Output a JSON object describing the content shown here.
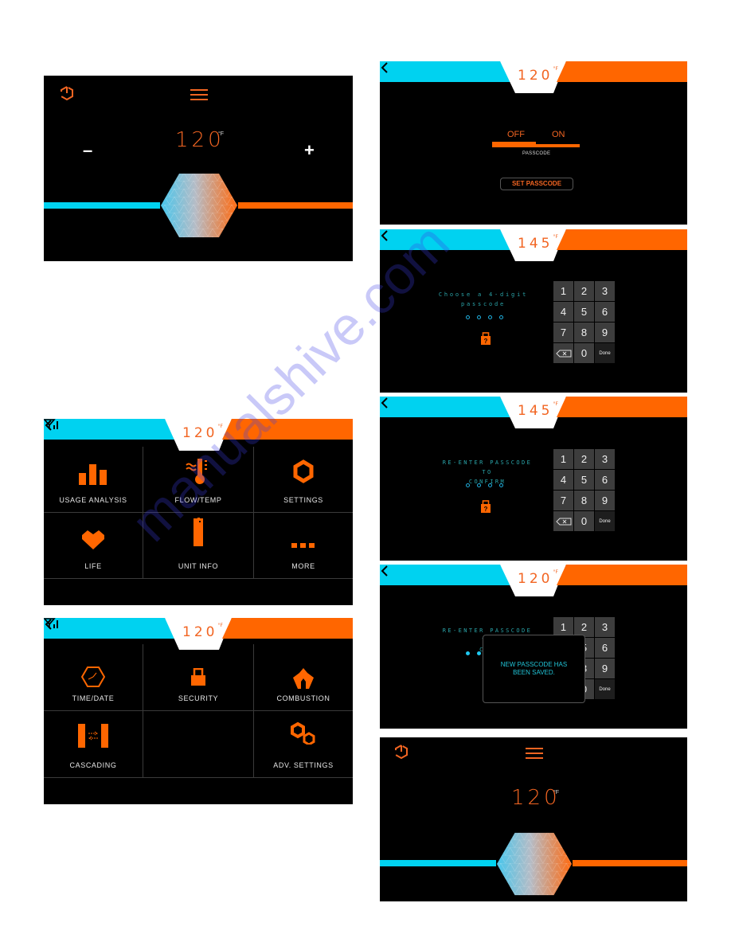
{
  "colors": {
    "cyan": "#00d2f0",
    "orange": "#ff6600",
    "accent_text": "#f26522",
    "background": "#000000"
  },
  "home_screen_top": {
    "power_icon": "power-icon",
    "menu_icon": "hamburger-menu-icon",
    "temperature": "120",
    "unit": "°F",
    "minus_label": "–",
    "plus_label": "+"
  },
  "main_menu": {
    "back_icon": "chevron-left-icon",
    "temperature": "120",
    "unit": "°F",
    "signal_icon": "wifi-signal-icon",
    "items": [
      {
        "label": "USAGE ANALYSIS",
        "icon": "bar-chart-icon"
      },
      {
        "label": "FLOW/TEMP",
        "icon": "thermometer-icon"
      },
      {
        "label": "SETTINGS",
        "icon": "hex-gear-icon"
      },
      {
        "label": "LIFE",
        "icon": "heart-icon"
      },
      {
        "label": "UNIT INFO",
        "icon": "unit-icon"
      },
      {
        "label": "MORE",
        "icon": "more-dots-icon"
      }
    ]
  },
  "more_menu": {
    "temperature": "120",
    "unit": "°F",
    "items": [
      {
        "label": "TIME/DATE",
        "icon": "clock-icon"
      },
      {
        "label": "SECURITY",
        "icon": "lock-icon"
      },
      {
        "label": "COMBUSTION",
        "icon": "flame-icon"
      },
      {
        "label": "CASCADING",
        "icon": "cascading-icon"
      },
      {
        "label": "",
        "icon": ""
      },
      {
        "label": "ADV. SETTINGS",
        "icon": "gears-icon"
      }
    ]
  },
  "security_screen": {
    "temperature": "120",
    "unit": "°F",
    "toggle_off": "OFF",
    "toggle_on": "ON",
    "toggle_state": "OFF",
    "passcode_label": "PASSCODE",
    "set_passcode_button": "SET PASSCODE"
  },
  "choose_passcode_screen": {
    "temperature": "145",
    "unit": "°F",
    "prompt_line1": "Choose a 4-digit",
    "prompt_line2": "passcode",
    "digits_entered": 0,
    "digits_total": 4
  },
  "reenter_passcode_screen": {
    "temperature": "145",
    "unit": "°F",
    "prompt_line1": "RE-ENTER PASSCODE TO",
    "prompt_line2": "CONFIRM",
    "digits_entered": 0,
    "digits_total": 4
  },
  "saved_screen": {
    "temperature": "120",
    "unit": "°F",
    "prompt_line1": "RE-ENTER PASSCODE TO",
    "prompt_line2": "CON",
    "digits_entered": 2,
    "toast_line1": "NEW PASSCODE HAS",
    "toast_line2": "BEEN SAVED."
  },
  "home_screen_bottom": {
    "temperature": "120",
    "unit": "°F"
  },
  "keypad": {
    "keys": [
      "1",
      "2",
      "3",
      "4",
      "5",
      "6",
      "7",
      "8",
      "9",
      "⌫",
      "0",
      "Done"
    ]
  },
  "watermark": "manualshive.com"
}
